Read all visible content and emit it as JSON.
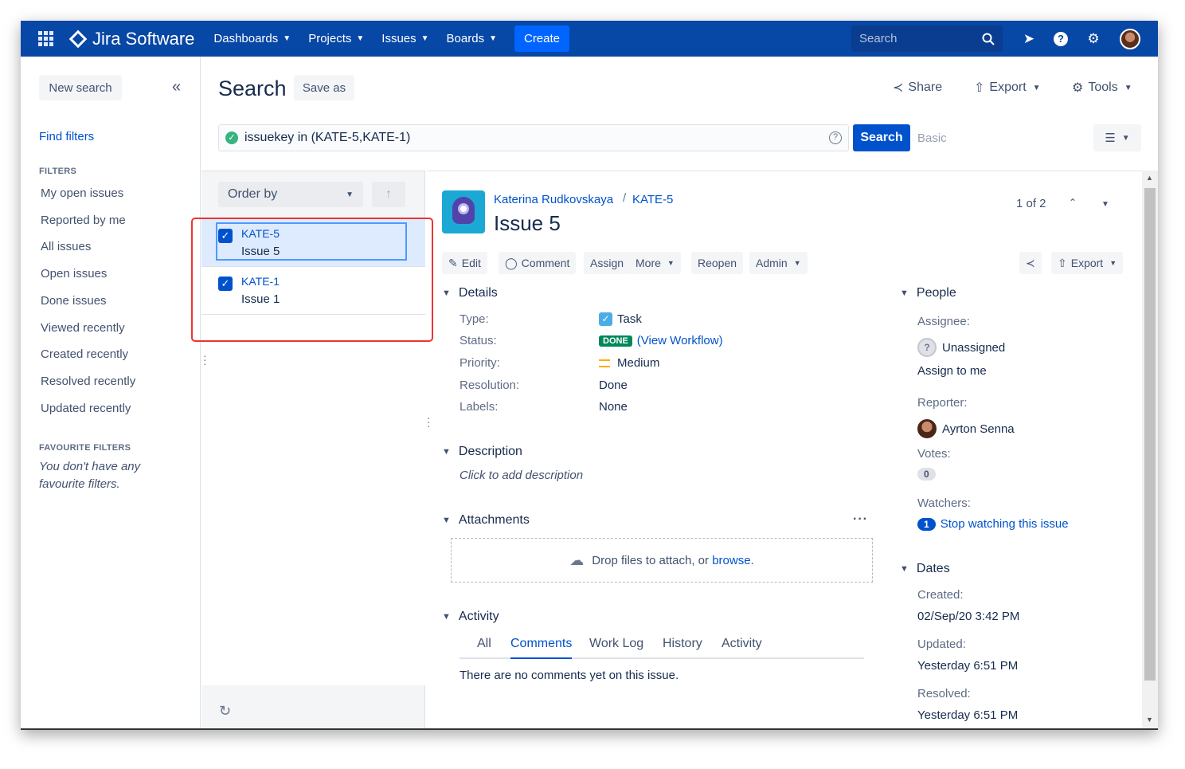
{
  "nav": {
    "product": "Jira Software",
    "items": [
      "Dashboards",
      "Projects",
      "Issues",
      "Boards"
    ],
    "create": "Create",
    "search_placeholder": "Search"
  },
  "sidebar": {
    "new_search": "New search",
    "find_filters": "Find filters",
    "filters_label": "FILTERS",
    "filters": [
      "My open issues",
      "Reported by me",
      "All issues",
      "Open issues",
      "Done issues",
      "Viewed recently",
      "Created recently",
      "Resolved recently",
      "Updated recently"
    ],
    "favourite_label": "FAVOURITE FILTERS",
    "favourite_note": "You don't have any favourite filters."
  },
  "header": {
    "title": "Search",
    "save_as": "Save as",
    "share": "Share",
    "export": "Export",
    "tools": "Tools",
    "jql": "issuekey in (KATE-5,KATE-1)",
    "search_button": "Search",
    "basic": "Basic"
  },
  "list": {
    "order_by": "Order by",
    "issues": [
      {
        "key": "KATE-5",
        "summary": "Issue 5"
      },
      {
        "key": "KATE-1",
        "summary": "Issue 1"
      }
    ]
  },
  "issue": {
    "breadcrumb_project": "Katerina Rudkovskaya",
    "breadcrumb_key": "KATE-5",
    "title": "Issue 5",
    "pager": "1 of 2",
    "ops": [
      "Edit",
      "Comment",
      "Assign",
      "More",
      "Reopen",
      "Admin"
    ],
    "export": "Export",
    "details_heading": "Details",
    "details": {
      "type_label": "Type:",
      "type": "Task",
      "status_label": "Status:",
      "status": "DONE",
      "workflow": "(View Workflow)",
      "priority_label": "Priority:",
      "priority": "Medium",
      "resolution_label": "Resolution:",
      "resolution": "Done",
      "labels_label": "Labels:",
      "labels": "None"
    },
    "description_heading": "Description",
    "description_placeholder": "Click to add description",
    "attachments_heading": "Attachments",
    "drop_text": "Drop files to attach, or",
    "browse": "browse.",
    "activity_heading": "Activity",
    "activity_tabs": [
      "All",
      "Comments",
      "Work Log",
      "History",
      "Activity"
    ],
    "no_comments": "There are no comments yet on this issue."
  },
  "people": {
    "heading": "People",
    "assignee_label": "Assignee:",
    "assignee": "Unassigned",
    "assign_to_me": "Assign to me",
    "reporter_label": "Reporter:",
    "reporter": "Ayrton Senna",
    "votes_label": "Votes:",
    "votes": "0",
    "watchers_label": "Watchers:",
    "watchers_count": "1",
    "stop_watching": "Stop watching this issue"
  },
  "dates": {
    "heading": "Dates",
    "created_label": "Created:",
    "created": "02/Sep/20 3:42 PM",
    "updated_label": "Updated:",
    "updated": "Yesterday 6:51 PM",
    "resolved_label": "Resolved:",
    "resolved": "Yesterday 6:51 PM"
  },
  "colors": {
    "nav": "#0747a6",
    "primary": "#0052cc",
    "done": "#00875a",
    "highlight": "#ee3333"
  }
}
